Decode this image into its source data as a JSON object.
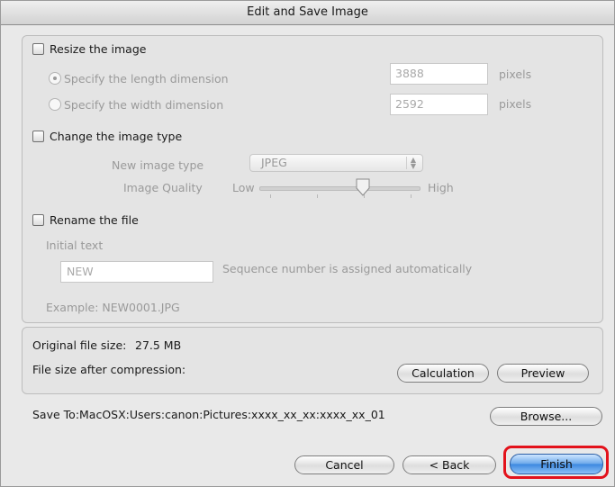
{
  "window": {
    "title": "Edit and Save Image"
  },
  "resize": {
    "label": "Resize the image",
    "length_label": "Specify the length dimension",
    "length_value": "3888",
    "width_label": "Specify the width dimension",
    "width_value": "2592",
    "unit": "pixels"
  },
  "type": {
    "label": "Change the image type",
    "new_type_label": "New image type",
    "new_type_value": "JPEG",
    "quality_label": "Image Quality",
    "low": "Low",
    "high": "High",
    "quality_level": 0.65
  },
  "rename": {
    "label": "Rename the file",
    "initial_text_label": "Initial text",
    "initial_text_value": "NEW",
    "sequence_note": "Sequence number is assigned automatically",
    "example": "Example:  NEW0001.JPG"
  },
  "size": {
    "original_label": "Original file size:",
    "original_value": "27.5 MB",
    "compressed_label": "File size after compression:",
    "calculation": "Calculation",
    "preview": "Preview"
  },
  "save": {
    "path": "Save To:MacOSX:Users:canon:Pictures:xxxx_xx_xx:xxxx_xx_01",
    "browse": "Browse..."
  },
  "footer": {
    "cancel": "Cancel",
    "back": "< Back",
    "finish": "Finish"
  },
  "highlight_color": "#e3121b"
}
